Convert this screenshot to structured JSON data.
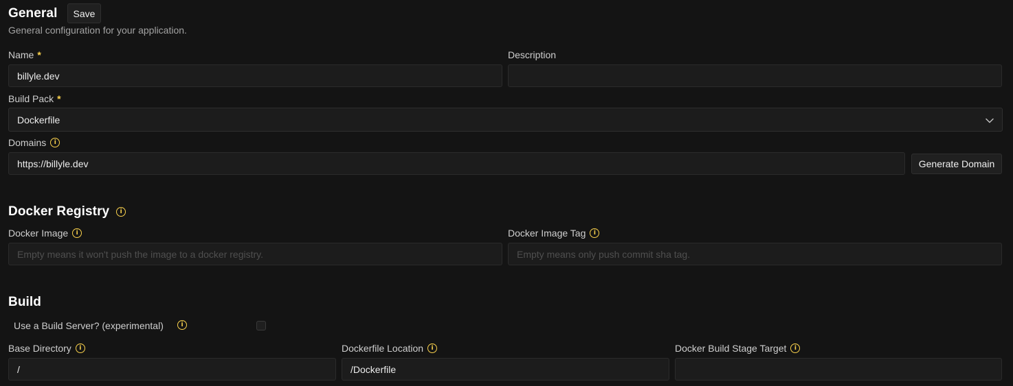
{
  "general": {
    "title": "General",
    "save_label": "Save",
    "subtitle": "General configuration for your application.",
    "name": {
      "label": "Name",
      "required_mark": "*",
      "value": "billyle.dev"
    },
    "description": {
      "label": "Description",
      "value": ""
    },
    "build_pack": {
      "label": "Build Pack",
      "required_mark": "*",
      "selected": "Dockerfile"
    },
    "domains": {
      "label": "Domains",
      "value": "https://billyle.dev",
      "generate_label": "Generate Domain"
    }
  },
  "docker_registry": {
    "title": "Docker Registry",
    "image": {
      "label": "Docker Image",
      "placeholder": "Empty means it won't push the image to a docker registry."
    },
    "image_tag": {
      "label": "Docker Image Tag",
      "placeholder": "Empty means only push commit sha tag."
    }
  },
  "build": {
    "title": "Build",
    "build_server": {
      "label": "Use a Build Server? (experimental)",
      "checked": false
    },
    "base_directory": {
      "label": "Base Directory",
      "value": "/"
    },
    "dockerfile_location": {
      "label": "Dockerfile Location",
      "value": "/Dockerfile"
    },
    "build_stage_target": {
      "label": "Docker Build Stage Target",
      "value": ""
    }
  },
  "icons": {
    "info": "info-icon",
    "chevron": "chevron-down-icon"
  },
  "colors": {
    "background": "#141414",
    "input_background": "#1c1c1c",
    "accent_warning": "#fcd34d"
  }
}
